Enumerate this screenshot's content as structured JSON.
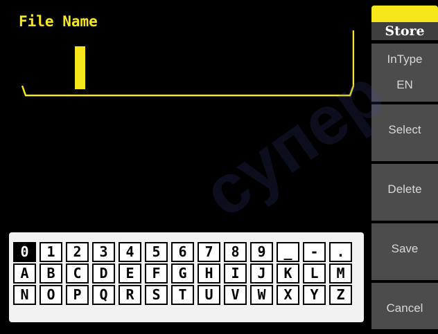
{
  "filename": {
    "label": "File Name",
    "value": ""
  },
  "keyboard": {
    "rows": [
      [
        "0",
        "1",
        "2",
        "3",
        "4",
        "5",
        "6",
        "7",
        "8",
        "9",
        "_",
        "-",
        "."
      ],
      [
        "A",
        "B",
        "C",
        "D",
        "E",
        "F",
        "G",
        "H",
        "I",
        "J",
        "K",
        "L",
        "M"
      ],
      [
        "N",
        "O",
        "P",
        "Q",
        "R",
        "S",
        "T",
        "U",
        "V",
        "W",
        "X",
        "Y",
        "Z"
      ]
    ],
    "selected": "0"
  },
  "menu": {
    "title": "Store",
    "intype_label": "InType",
    "intype_value": "EN",
    "select": "Select",
    "delete": "Delete",
    "save": "Save",
    "cancel": "Cancel"
  },
  "watermark": {
    "text": "супер"
  },
  "colors": {
    "accent": "#f5e71b",
    "softkey_bg": "#4c4c4c",
    "background": "#000000"
  }
}
